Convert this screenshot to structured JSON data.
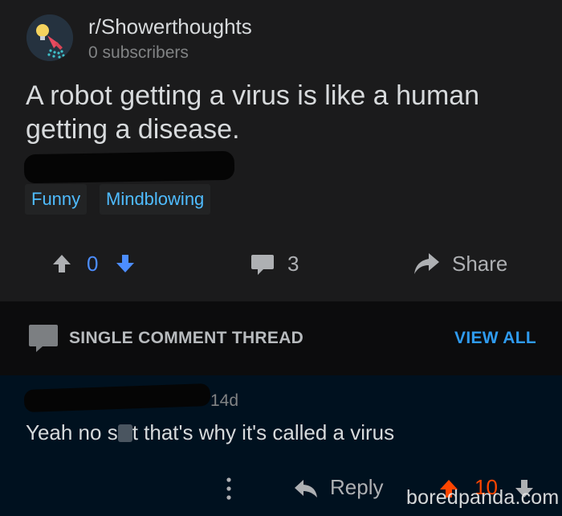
{
  "post": {
    "subreddit": "r/Showerthoughts",
    "subscribers": "0 subscribers",
    "title": "A robot getting a virus is like a human getting a disease.",
    "flairs": [
      "Funny",
      "Mindblowing"
    ],
    "score": "0",
    "comments": "3",
    "share_label": "Share"
  },
  "thread": {
    "title": "SINGLE COMMENT THREAD",
    "view_all": "VIEW ALL"
  },
  "comment": {
    "age": "14d",
    "body_before": "Yeah no s",
    "body_after": "t that's why it's called a virus",
    "reply_label": "Reply",
    "score": "10"
  },
  "watermark": "boredpanda.com",
  "colors": {
    "background": "#1b1b1c",
    "vote_blue": "#4c8dff",
    "upvote_orange": "#ff4500",
    "flair_blue": "#4fbcff",
    "comment_bg": "#00111f"
  },
  "icons": [
    "shower-head-icon",
    "upvote-arrow-icon",
    "downvote-arrow-icon",
    "comment-bubble-icon",
    "share-arrow-icon",
    "more-dots-icon",
    "reply-arrow-icon"
  ]
}
